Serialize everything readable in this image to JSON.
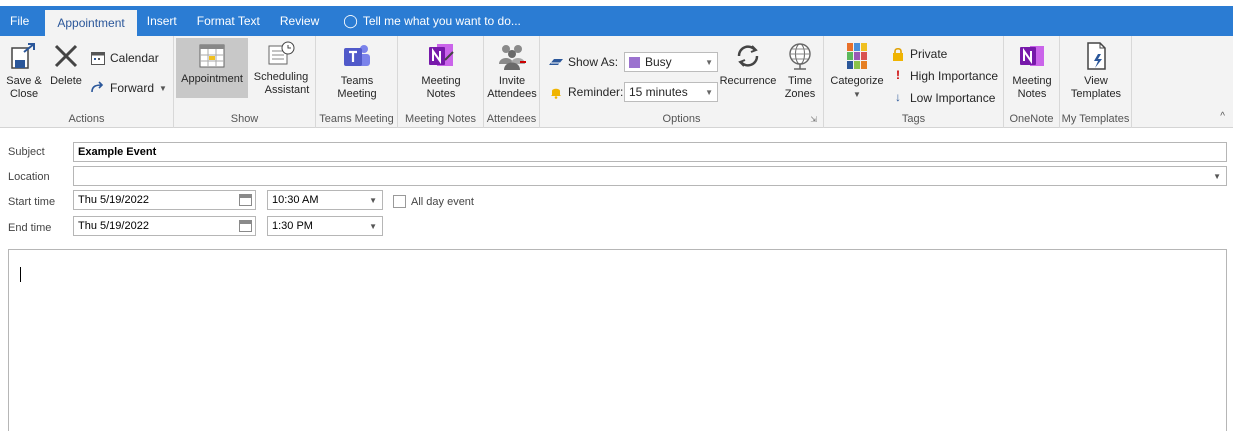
{
  "tabs": [
    "File",
    "Appointment",
    "Insert",
    "Format Text",
    "Review"
  ],
  "tell_me": "Tell me what you want to do...",
  "ribbon": {
    "actions": {
      "save_close_1": "Save &",
      "save_close_2": "Close",
      "delete": "Delete",
      "calendar": "Calendar",
      "forward": "Forward",
      "label": "Actions"
    },
    "show": {
      "appointment": "Appointment",
      "scheduling_1": "Scheduling",
      "scheduling_2": "Assistant",
      "label": "Show"
    },
    "teams": {
      "btn_1": "Teams",
      "btn_2": "Meeting",
      "label": "Teams Meeting"
    },
    "meeting_notes": {
      "btn_1": "Meeting",
      "btn_2": "Notes",
      "label": "Meeting Notes"
    },
    "attendees": {
      "btn_1": "Invite",
      "btn_2": "Attendees",
      "label": "Attendees"
    },
    "options": {
      "show_as_label": "Show As:",
      "show_as_value": "Busy",
      "reminder_label": "Reminder:",
      "reminder_value": "15 minutes",
      "recurrence": "Recurrence",
      "time_zones_1": "Time",
      "time_zones_2": "Zones",
      "label": "Options"
    },
    "tags": {
      "categorize": "Categorize",
      "private": "Private",
      "high": "High Importance",
      "low": "Low Importance",
      "label": "Tags"
    },
    "onenote": {
      "btn_1": "Meeting",
      "btn_2": "Notes",
      "label": "OneNote"
    },
    "templates": {
      "btn_1": "View",
      "btn_2": "Templates",
      "label": "My Templates"
    }
  },
  "form": {
    "subject_label": "Subject",
    "subject_value": "Example Event",
    "location_label": "Location",
    "location_value": "",
    "start_label": "Start time",
    "start_date": "Thu 5/19/2022",
    "start_time": "10:30 AM",
    "all_day": "All day event",
    "end_label": "End time",
    "end_date": "Thu 5/19/2022",
    "end_time": "1:30 PM"
  },
  "colors": {
    "accent": "#2b7cd3",
    "busy": "#9b72cf",
    "teams": "#5059c9",
    "onenote": "#7719aa"
  }
}
